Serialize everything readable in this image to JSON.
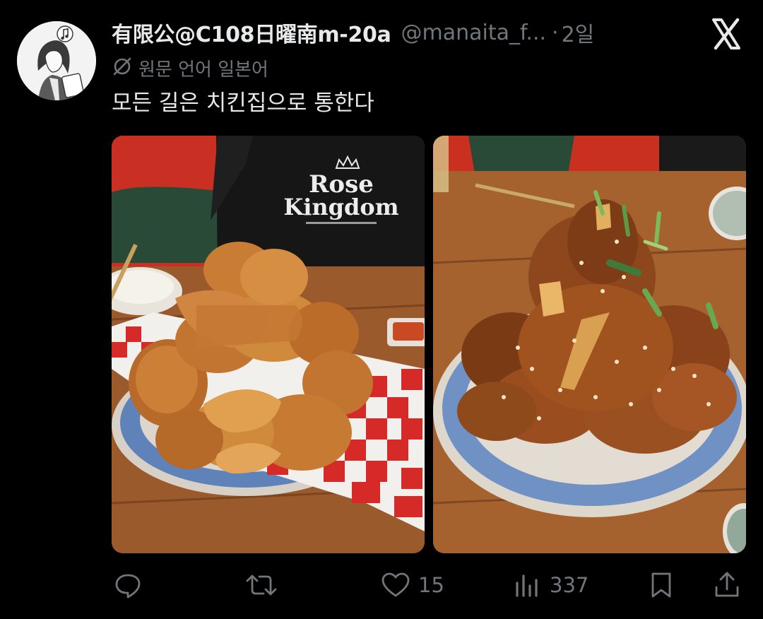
{
  "tweet": {
    "display_name": "有限公@C108日曜南m-20a",
    "handle": "@manaita_f...",
    "separator": "·",
    "time": "2일",
    "translate_label": "원문 언어 일본어",
    "text": "모든 길은 치킨집으로 통한다"
  },
  "images": [
    {
      "shirt_text_line1": "Rose",
      "shirt_text_line2": "Kingdom"
    }
  ],
  "actions": {
    "reply_count": "",
    "retweet_count": "",
    "like_count": "15",
    "views_count": "337"
  },
  "colors": {
    "background": "#000000",
    "text_primary": "#e7e9ea",
    "text_secondary": "#71767b"
  },
  "icons": [
    "x-logo-icon",
    "translate-icon",
    "reply-icon",
    "retweet-icon",
    "like-icon",
    "views-icon",
    "bookmark-icon",
    "share-icon"
  ]
}
